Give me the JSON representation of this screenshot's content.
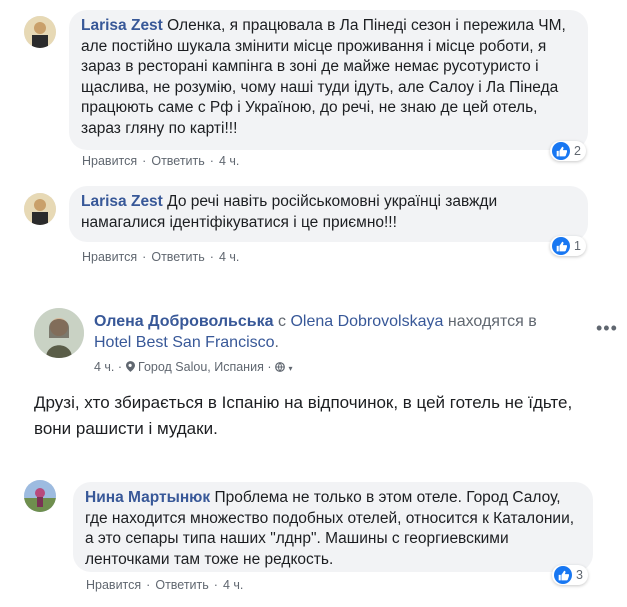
{
  "comments": [
    {
      "author": "Larisa Zest",
      "text": "Оленка, я працювала в Ла Пінеді сезон і пережила ЧМ, але постійно шукала змінити місце проживання і місце роботи, я зараз в ресторані кампінга в зоні де майже немає русотуристо і щаслива, не розумію, чому наші туди ідуть, але Салоу і Ла Пінеда працюють саме с Рф і Україною, до речі, не знаю де цей отель, зараз гляну по карті!!!",
      "like_label": "Нравится",
      "reply_label": "Ответить",
      "time": "4 ч.",
      "reactions": "2"
    },
    {
      "author": "Larisa Zest",
      "text": "До речі навіть російськомовні українці завжди намагалися ідентіфікуватися і це приємно!!!",
      "like_label": "Нравится",
      "reply_label": "Ответить",
      "time": "4 ч.",
      "reactions": "1"
    },
    {
      "author": "Нина Мартынюк",
      "text": "Проблема не только в этом отеле. Город Салоу, где находится множество подобных отелей, относится к Каталонии, а это сепары типа наших \"лднр\". Машины с георгиевскими ленточками там тоже не редкость.",
      "like_label": "Нравится",
      "reply_label": "Ответить",
      "time": "4 ч.",
      "reactions": "3"
    }
  ],
  "post": {
    "author": "Олена Добровольська",
    "with_word": "с",
    "tagged": "Olena Dobrovolskaya",
    "location_word": "находятся в",
    "place": "Hotel Best San Francisco",
    "place_suffix": ".",
    "time": "4 ч.",
    "location": "Город Salou, Испания",
    "text": "Друзі, хто збирається в Іспанію на відпочинок, в цей готель не їдьте, вони рашисти і мудаки.",
    "more_icon": "ellipsis-icon"
  },
  "colors": {
    "author_link": "#385898",
    "bubble_bg": "#f2f3f5",
    "like_blue": "#1877f2",
    "muted": "#606770"
  }
}
